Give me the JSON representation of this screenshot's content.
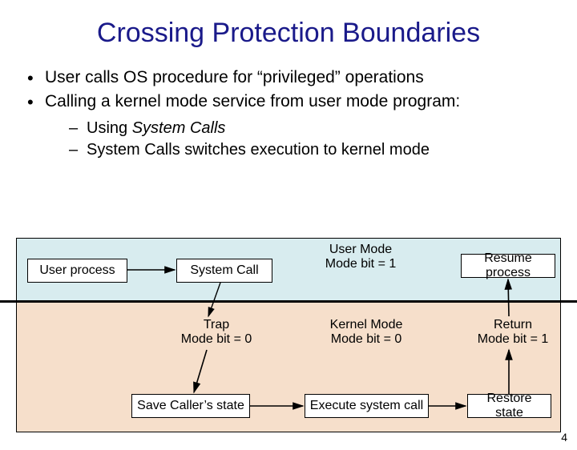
{
  "title": "Crossing Protection Boundaries",
  "bullets": {
    "b1": "User calls OS procedure for “privileged” operations",
    "b2": "Calling a kernel mode service from user mode program:",
    "s1_prefix": "Using ",
    "s1_em": "System Calls",
    "s2": "System Calls switches execution to kernel mode"
  },
  "boxes": {
    "user_process": "User process",
    "system_call": "System Call",
    "resume_process": "Resume process",
    "save_state": "Save Caller’s state",
    "exec_syscall": "Execute system call",
    "restore_state": "Restore state"
  },
  "labels": {
    "user_mode_l1": "User Mode",
    "user_mode_l2": "Mode bit = 1",
    "trap_l1": "Trap",
    "trap_l2": "Mode bit = 0",
    "kernel_mode_l1": "Kernel Mode",
    "kernel_mode_l2": "Mode bit = 0",
    "return_l1": "Return",
    "return_l2": "Mode bit = 1"
  },
  "page_number": "4"
}
